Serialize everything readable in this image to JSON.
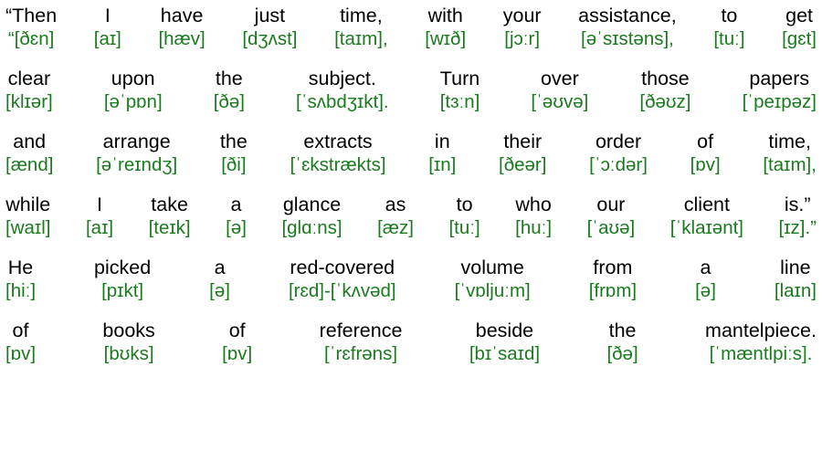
{
  "document": {
    "type": "interlinear-ipa-transcription",
    "text_color": "#000000",
    "ipa_color": "#1a7a1e",
    "background": "#ffffff"
  },
  "lines": [
    {
      "id": "line-1",
      "orthographic": "“Then I have just time, with your assistance, to get",
      "ipa": "“[ðɛn] [aɪ] [hæv] [dʒʌst] [taɪm], [wɪð] [jɔːr] [əˈsɪstəns], [tuː] [gɛt]",
      "tokens": [
        {
          "word": "“Then",
          "ipa": "“[ðɛn]"
        },
        {
          "word": "I",
          "ipa": "[aɪ]"
        },
        {
          "word": "have",
          "ipa": "[hæv]"
        },
        {
          "word": "just",
          "ipa": "[dʒʌst]"
        },
        {
          "word": "time,",
          "ipa": "[taɪm],"
        },
        {
          "word": "with",
          "ipa": "[wɪð]"
        },
        {
          "word": "your",
          "ipa": "[jɔːr]"
        },
        {
          "word": "assistance,",
          "ipa": "[əˈsɪstəns],"
        },
        {
          "word": "to",
          "ipa": "[tuː]"
        },
        {
          "word": "get",
          "ipa": "[gɛt]"
        }
      ]
    },
    {
      "id": "line-2",
      "orthographic": "clear upon the subject. Turn over those papers",
      "ipa": "[klɪər] [əˈpɒn] [ðə] [ˈsʌbdʒɪkt]. [tɜːn] [ˈəʊvə] [ðəʊz] [ˈpeɪpəz]",
      "tokens": [
        {
          "word": "clear",
          "ipa": "[klɪər]"
        },
        {
          "word": "upon",
          "ipa": "[əˈpɒn]"
        },
        {
          "word": "the",
          "ipa": "[ðə]"
        },
        {
          "word": "subject.",
          "ipa": "[ˈsʌbdʒɪkt]."
        },
        {
          "word": "Turn",
          "ipa": "[tɜːn]"
        },
        {
          "word": "over",
          "ipa": "[ˈəʊvə]"
        },
        {
          "word": "those",
          "ipa": "[ðəʊz]"
        },
        {
          "word": "papers",
          "ipa": "[ˈpeɪpəz]"
        }
      ]
    },
    {
      "id": "line-3",
      "orthographic": "and arrange the extracts in their order of time,",
      "ipa": "[ænd] [əˈreɪndʒ] [ði] [ˈɛkstrækts] [ɪn] [ðeər] [ˈɔːdər] [ɒv] [taɪm],",
      "tokens": [
        {
          "word": "and",
          "ipa": "[ænd]"
        },
        {
          "word": "arrange",
          "ipa": "[əˈreɪndʒ]"
        },
        {
          "word": "the",
          "ipa": "[ði]"
        },
        {
          "word": "extracts",
          "ipa": "[ˈɛkstrækts]"
        },
        {
          "word": "in",
          "ipa": "[ɪn]"
        },
        {
          "word": "their",
          "ipa": "[ðeər]"
        },
        {
          "word": "order",
          "ipa": "[ˈɔːdər]"
        },
        {
          "word": "of",
          "ipa": "[ɒv]"
        },
        {
          "word": "time,",
          "ipa": "[taɪm],"
        }
      ]
    },
    {
      "id": "line-4",
      "orthographic": "while I take a glance as to who our client is.”",
      "ipa": "[waɪl] [aɪ] [teɪk] [ə] [glɑːns] [æz] [tuː] [huː] [ˈaʊə] [ˈklaɪənt] [ɪz].”",
      "tokens": [
        {
          "word": "while",
          "ipa": "[waɪl]"
        },
        {
          "word": "I",
          "ipa": "[aɪ]"
        },
        {
          "word": "take",
          "ipa": "[teɪk]"
        },
        {
          "word": "a",
          "ipa": "[ə]"
        },
        {
          "word": "glance",
          "ipa": "[glɑːns]"
        },
        {
          "word": "as",
          "ipa": "[æz]"
        },
        {
          "word": "to",
          "ipa": "[tuː]"
        },
        {
          "word": "who",
          "ipa": "[huː]"
        },
        {
          "word": "our",
          "ipa": "[ˈaʊə]"
        },
        {
          "word": "client",
          "ipa": "[ˈklaɪənt]"
        },
        {
          "word": "is.”",
          "ipa": "[ɪz].”"
        }
      ]
    },
    {
      "id": "line-5",
      "orthographic": "He picked a red-covered volume from a line",
      "ipa": "[hiː] [pɪkt] [ə] [rɛd]-[ˈkʌvəd] [ˈvɒljuːm] [frɒm] [ə] [laɪn]",
      "tokens": [
        {
          "word": "He",
          "ipa": "[hiː]"
        },
        {
          "word": "picked",
          "ipa": "[pɪkt]"
        },
        {
          "word": "a",
          "ipa": "[ə]"
        },
        {
          "word": "red-covered",
          "ipa": "[rɛd]-[ˈkʌvəd]"
        },
        {
          "word": "volume",
          "ipa": "[ˈvɒljuːm]"
        },
        {
          "word": "from",
          "ipa": "[frɒm]"
        },
        {
          "word": "a",
          "ipa": "[ə]"
        },
        {
          "word": "line",
          "ipa": "[laɪn]"
        }
      ]
    },
    {
      "id": "line-6",
      "orthographic": "of books of reference beside the mantelpiece.",
      "ipa": "[ɒv] [bʊks] [ɒv] [ˈrɛfrəns] [bɪˈsaɪd] [ðə] [ˈmæntlpiːs].",
      "tokens": [
        {
          "word": "of",
          "ipa": "[ɒv]"
        },
        {
          "word": "books",
          "ipa": "[bʊks]"
        },
        {
          "word": "of",
          "ipa": "[ɒv]"
        },
        {
          "word": "reference",
          "ipa": "[ˈrɛfrəns]"
        },
        {
          "word": "beside",
          "ipa": "[bɪˈsaɪd]"
        },
        {
          "word": "the",
          "ipa": "[ðə]"
        },
        {
          "word": "mantelpiece.",
          "ipa": "[ˈmæntlpiːs]."
        }
      ]
    }
  ]
}
